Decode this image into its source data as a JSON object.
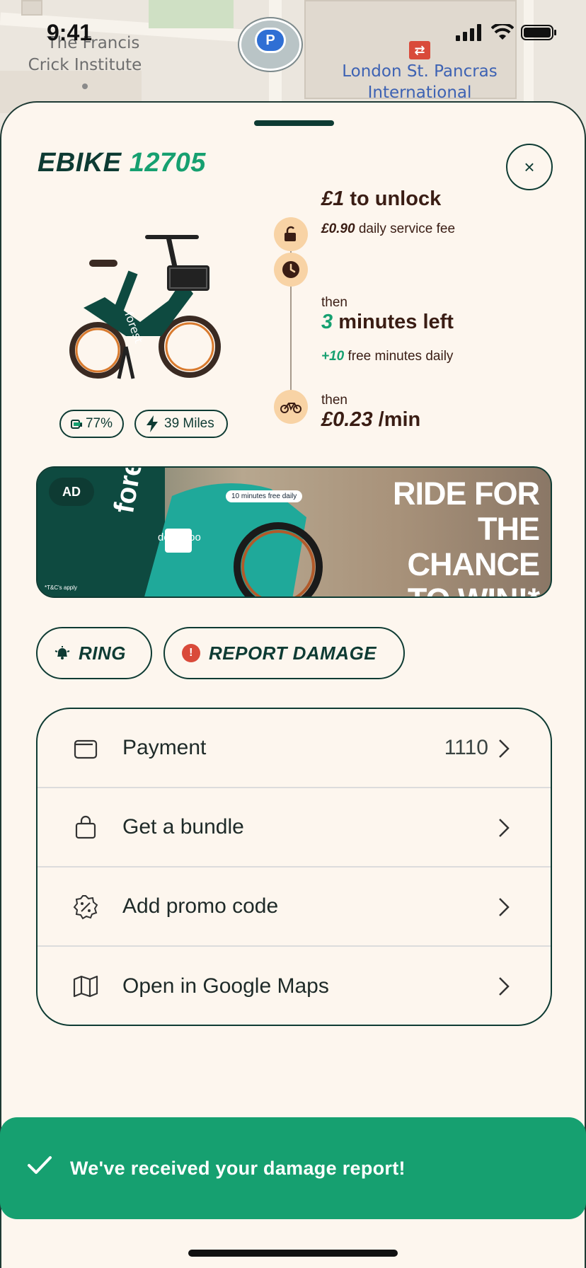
{
  "status_bar": {
    "time": "9:41"
  },
  "map": {
    "labels": [
      "The Francis",
      "Crick Institute",
      "London St. Pancras",
      "International"
    ],
    "parking_symbol": "P",
    "rail_symbol": "⇄"
  },
  "sheet": {
    "title_prefix": "EBIKE",
    "title_number": "12705",
    "close_icon": "×"
  },
  "bike": {
    "battery": "77%",
    "range": "39 Miles"
  },
  "pricing": {
    "unlock_price": "£1",
    "unlock_text": " to unlock",
    "service_fee": "£0.90",
    "service_fee_text": " daily service fee",
    "then_1": "then",
    "minutes_num": "3",
    "minutes_text": " minutes left",
    "free_minutes": "+10",
    "free_minutes_text": " free minutes daily",
    "then_2": "then",
    "rate_price": "£0.23",
    "rate_unit": " /min"
  },
  "ad": {
    "badge": "AD",
    "headline_1": "RIDE FOR",
    "headline_2": "THE CHANCE",
    "headline_3": "← TO WIN!*",
    "fine_print": "*T&C's apply",
    "frame_text": "10 minutes free daily",
    "brand": "deliveroo",
    "bike_brand": "forest"
  },
  "actions": {
    "ring": "RING",
    "report": "REPORT DAMAGE"
  },
  "menu": {
    "items": [
      {
        "label": "Payment",
        "value": "1110",
        "icon": "wallet-icon"
      },
      {
        "label": "Get a bundle",
        "value": "",
        "icon": "shopping-bag-icon"
      },
      {
        "label": "Add promo code",
        "value": "",
        "icon": "discount-badge-icon"
      },
      {
        "label": "Open in Google Maps",
        "value": "",
        "icon": "map-icon"
      }
    ]
  },
  "toast": {
    "message": "We've received your damage report!"
  },
  "colors": {
    "brand_dark": "#0e3b33",
    "brand_green": "#16a070",
    "sheet_bg": "#fdf6ee",
    "accent_peach": "#f8d3a5",
    "alert_red": "#d94a3a"
  }
}
